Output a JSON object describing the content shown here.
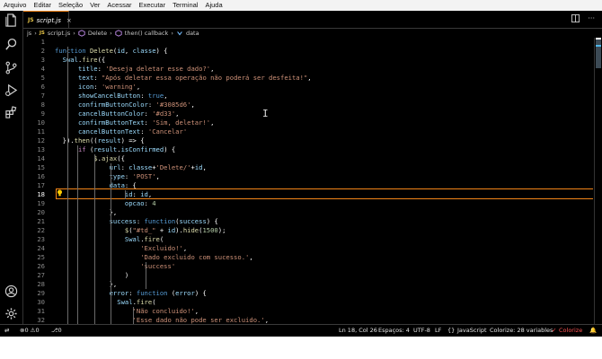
{
  "menu": [
    "Arquivo",
    "Editar",
    "Seleção",
    "Ver",
    "Acessar",
    "Executar",
    "Terminal",
    "Ajuda"
  ],
  "tab": {
    "icon_text": "JS",
    "filename": "script.js",
    "close": "×"
  },
  "breadcrumb": {
    "folder": "js",
    "sep": "›",
    "file_icon": "JS",
    "file": "script.js",
    "fn": "Delete",
    "callback": "then() callback",
    "var": "data"
  },
  "code_lines": [
    {
      "n": "1",
      "tokens": []
    },
    {
      "n": "2",
      "tokens": [
        [
          "kw",
          "function "
        ],
        [
          "fn",
          "Delete"
        ],
        [
          "",
          "("
        ],
        [
          "prop",
          "id"
        ],
        [
          "",
          ", "
        ],
        [
          "prop",
          "classe"
        ],
        [
          "",
          ") {"
        ]
      ]
    },
    {
      "n": "3",
      "tokens": [
        [
          "",
          "  "
        ],
        [
          "prop",
          "Swal"
        ],
        [
          "",
          "."
        ],
        [
          "fn",
          "fire"
        ],
        [
          "",
          "({"
        ]
      ]
    },
    {
      "n": "4",
      "tokens": [
        [
          "",
          "      "
        ],
        [
          "prop",
          "title"
        ],
        [
          "",
          ": "
        ],
        [
          "str",
          "'Deseja deletar esse dado?'"
        ],
        [
          "",
          ","
        ]
      ]
    },
    {
      "n": "5",
      "tokens": [
        [
          "",
          "      "
        ],
        [
          "prop",
          "text"
        ],
        [
          "",
          ": "
        ],
        [
          "str",
          "\"Após deletar essa operação não poderá ser desfeita!\""
        ],
        [
          "",
          ","
        ]
      ]
    },
    {
      "n": "6",
      "tokens": [
        [
          "",
          "      "
        ],
        [
          "prop",
          "icon"
        ],
        [
          "",
          ": "
        ],
        [
          "str",
          "'warning'"
        ],
        [
          "",
          ","
        ]
      ]
    },
    {
      "n": "7",
      "tokens": [
        [
          "",
          "      "
        ],
        [
          "prop",
          "showCancelButton"
        ],
        [
          "",
          ": "
        ],
        [
          "kw",
          "true"
        ],
        [
          "",
          ","
        ]
      ]
    },
    {
      "n": "8",
      "tokens": [
        [
          "",
          "      "
        ],
        [
          "prop",
          "confirmButtonColor"
        ],
        [
          "",
          ": "
        ],
        [
          "str",
          "'#3085d6'"
        ],
        [
          "",
          ","
        ]
      ]
    },
    {
      "n": "9",
      "tokens": [
        [
          "",
          "      "
        ],
        [
          "prop",
          "cancelButtonColor"
        ],
        [
          "",
          ": "
        ],
        [
          "str",
          "'#d33'"
        ],
        [
          "",
          ","
        ]
      ]
    },
    {
      "n": "10",
      "tokens": [
        [
          "",
          "      "
        ],
        [
          "prop",
          "confirmButtonText"
        ],
        [
          "",
          ": "
        ],
        [
          "str",
          "'Sim, deletar!'"
        ],
        [
          "",
          ","
        ]
      ]
    },
    {
      "n": "11",
      "tokens": [
        [
          "",
          "      "
        ],
        [
          "prop",
          "cancelButtonText"
        ],
        [
          "",
          ": "
        ],
        [
          "str",
          "'Cancelar'"
        ]
      ]
    },
    {
      "n": "12",
      "tokens": [
        [
          "",
          "  })."
        ],
        [
          "fn",
          "then"
        ],
        [
          "",
          "(("
        ],
        [
          "prop",
          "result"
        ],
        [
          "",
          ") => {"
        ]
      ]
    },
    {
      "n": "13",
      "tokens": [
        [
          "",
          "      "
        ],
        [
          "ctl",
          "if"
        ],
        [
          "",
          " ("
        ],
        [
          "prop",
          "result"
        ],
        [
          "",
          "."
        ],
        [
          "prop",
          "isConfirmed"
        ],
        [
          "",
          ") {"
        ]
      ]
    },
    {
      "n": "14",
      "tokens": [
        [
          "",
          "          "
        ],
        [
          "fn",
          "$"
        ],
        [
          "",
          "."
        ],
        [
          "fn",
          "ajax"
        ],
        [
          "",
          "({"
        ]
      ]
    },
    {
      "n": "15",
      "tokens": [
        [
          "",
          "              "
        ],
        [
          "prop",
          "url"
        ],
        [
          "",
          ": "
        ],
        [
          "prop",
          "classe"
        ],
        [
          "",
          "+"
        ],
        [
          "str",
          "'Delete/'"
        ],
        [
          "",
          "+"
        ],
        [
          "prop",
          "id"
        ],
        [
          "",
          ","
        ]
      ]
    },
    {
      "n": "16",
      "tokens": [
        [
          "",
          "              "
        ],
        [
          "prop",
          "type"
        ],
        [
          "",
          ": "
        ],
        [
          "str",
          "'POST'"
        ],
        [
          "",
          ","
        ]
      ]
    },
    {
      "n": "17",
      "tokens": [
        [
          "",
          "              "
        ],
        [
          "prop",
          "data"
        ],
        [
          "",
          ": {"
        ]
      ]
    },
    {
      "n": "18",
      "tokens": [
        [
          "",
          "                  "
        ],
        [
          "prop",
          "id"
        ],
        [
          "",
          ": "
        ],
        [
          "prop",
          "id"
        ],
        [
          "",
          ","
        ]
      ]
    },
    {
      "n": "19",
      "tokens": [
        [
          "",
          "                  "
        ],
        [
          "prop",
          "opcao"
        ],
        [
          "",
          ": "
        ],
        [
          "num",
          "4"
        ]
      ]
    },
    {
      "n": "20",
      "tokens": [
        [
          "",
          "              },"
        ]
      ]
    },
    {
      "n": "21",
      "tokens": [
        [
          "",
          "              "
        ],
        [
          "prop",
          "success"
        ],
        [
          "",
          ": "
        ],
        [
          "kw",
          "function"
        ],
        [
          "",
          "("
        ],
        [
          "prop",
          "success"
        ],
        [
          "",
          ") {"
        ]
      ]
    },
    {
      "n": "22",
      "tokens": [
        [
          "",
          "                  "
        ],
        [
          "fn",
          "$"
        ],
        [
          "",
          "("
        ],
        [
          "str",
          "\"#td_\""
        ],
        [
          "",
          " + "
        ],
        [
          "prop",
          "id"
        ],
        [
          "",
          ")."
        ],
        [
          "fn",
          "hide"
        ],
        [
          "",
          "("
        ],
        [
          "num",
          "1500"
        ],
        [
          "",
          ");"
        ]
      ]
    },
    {
      "n": "23",
      "tokens": [
        [
          "",
          "                  "
        ],
        [
          "prop",
          "Swal"
        ],
        [
          "",
          "."
        ],
        [
          "fn",
          "fire"
        ],
        [
          "",
          "("
        ]
      ]
    },
    {
      "n": "24",
      "tokens": [
        [
          "",
          "                      "
        ],
        [
          "str",
          "'Excluido!'"
        ],
        [
          "",
          ","
        ]
      ]
    },
    {
      "n": "25",
      "tokens": [
        [
          "",
          "                      "
        ],
        [
          "str",
          "'Dado excluido com sucesso.'"
        ],
        [
          "",
          ","
        ]
      ]
    },
    {
      "n": "26",
      "tokens": [
        [
          "",
          "                      "
        ],
        [
          "str",
          "'success'"
        ]
      ]
    },
    {
      "n": "27",
      "tokens": [
        [
          "",
          "                  )"
        ]
      ]
    },
    {
      "n": "28",
      "tokens": [
        [
          "",
          "              },"
        ]
      ]
    },
    {
      "n": "29",
      "tokens": [
        [
          "",
          "              "
        ],
        [
          "prop",
          "error"
        ],
        [
          "",
          ": "
        ],
        [
          "kw",
          "function"
        ],
        [
          "",
          " ("
        ],
        [
          "prop",
          "error"
        ],
        [
          "",
          ") {"
        ]
      ]
    },
    {
      "n": "30",
      "tokens": [
        [
          "",
          "                "
        ],
        [
          "prop",
          "Swal"
        ],
        [
          "",
          "."
        ],
        [
          "fn",
          "fire"
        ],
        [
          "",
          "("
        ]
      ]
    },
    {
      "n": "31",
      "tokens": [
        [
          "",
          "                    "
        ],
        [
          "str",
          "'Não concluido!'"
        ],
        [
          "",
          ","
        ]
      ]
    },
    {
      "n": "32",
      "tokens": [
        [
          "",
          "                    "
        ],
        [
          "str",
          "'Esse dado não pode ser excluido.'"
        ],
        [
          "",
          ","
        ]
      ]
    }
  ],
  "current_line": "18",
  "status": {
    "remote": "⇄",
    "errors": "0",
    "warnings": "0",
    "ports": "0",
    "position": "Ln 18, Col 26",
    "spaces": "Espaços: 4",
    "encoding": "UTF-8",
    "eol": "LF",
    "language": "JavaScript",
    "colorize": "Colorize: 28 variables",
    "colorize_btn": "Colorize"
  },
  "colors": {
    "accent": "#f38518",
    "keyword": "#569cd6",
    "string": "#ce9178",
    "function": "#dcdcaa",
    "property": "#9cdcfe",
    "number": "#b5cea8"
  },
  "icons": [
    "explorer-icon",
    "search-icon",
    "source-control-icon",
    "run-debug-icon",
    "extensions-icon",
    "account-icon",
    "settings-gear-icon"
  ]
}
